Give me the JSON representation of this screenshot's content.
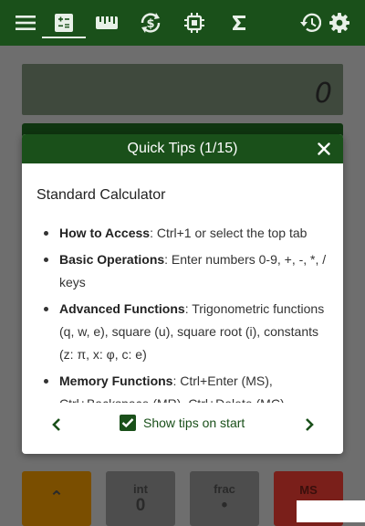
{
  "topbar": {
    "tabs": [
      {
        "name": "menu-icon"
      },
      {
        "name": "calculator-icon",
        "active": true
      },
      {
        "name": "ruler-icon"
      },
      {
        "name": "currency-exchange-icon"
      },
      {
        "name": "chip-icon"
      },
      {
        "name": "sigma-icon"
      }
    ],
    "actions": [
      {
        "name": "history-icon"
      },
      {
        "name": "settings-icon"
      }
    ],
    "colors": {
      "bar": "#1a501a",
      "icon": "#e8f0e8"
    }
  },
  "display": {
    "value": "0"
  },
  "keypad": {
    "keys": [
      {
        "sub": "",
        "main": "⌃"
      },
      {
        "sub": "int",
        "main": "0"
      },
      {
        "sub": "frac",
        "main": "•"
      },
      {
        "sub": "MS",
        "main": ""
      }
    ]
  },
  "dialog": {
    "title": "Quick Tips (1/15)",
    "heading": "Standard Calculator",
    "tips": [
      {
        "term": "How to Access",
        "text": ": Ctrl+1 or select the top tab"
      },
      {
        "term": "Basic Operations",
        "text": ": Enter numbers 0-9, +, -, *, / keys"
      },
      {
        "term": "Advanced Functions",
        "text": ": Trigonometric functions (q, w, e), square (u), square root (i), constants (z: π, x: φ, c: e)"
      },
      {
        "term": "Memory Functions",
        "text": ": Ctrl+Enter (MS), Ctrl+Backspace (MR), Ctrl+Delete (MC)"
      }
    ],
    "show_tips_label": "Show tips on start",
    "show_tips_checked": true
  }
}
